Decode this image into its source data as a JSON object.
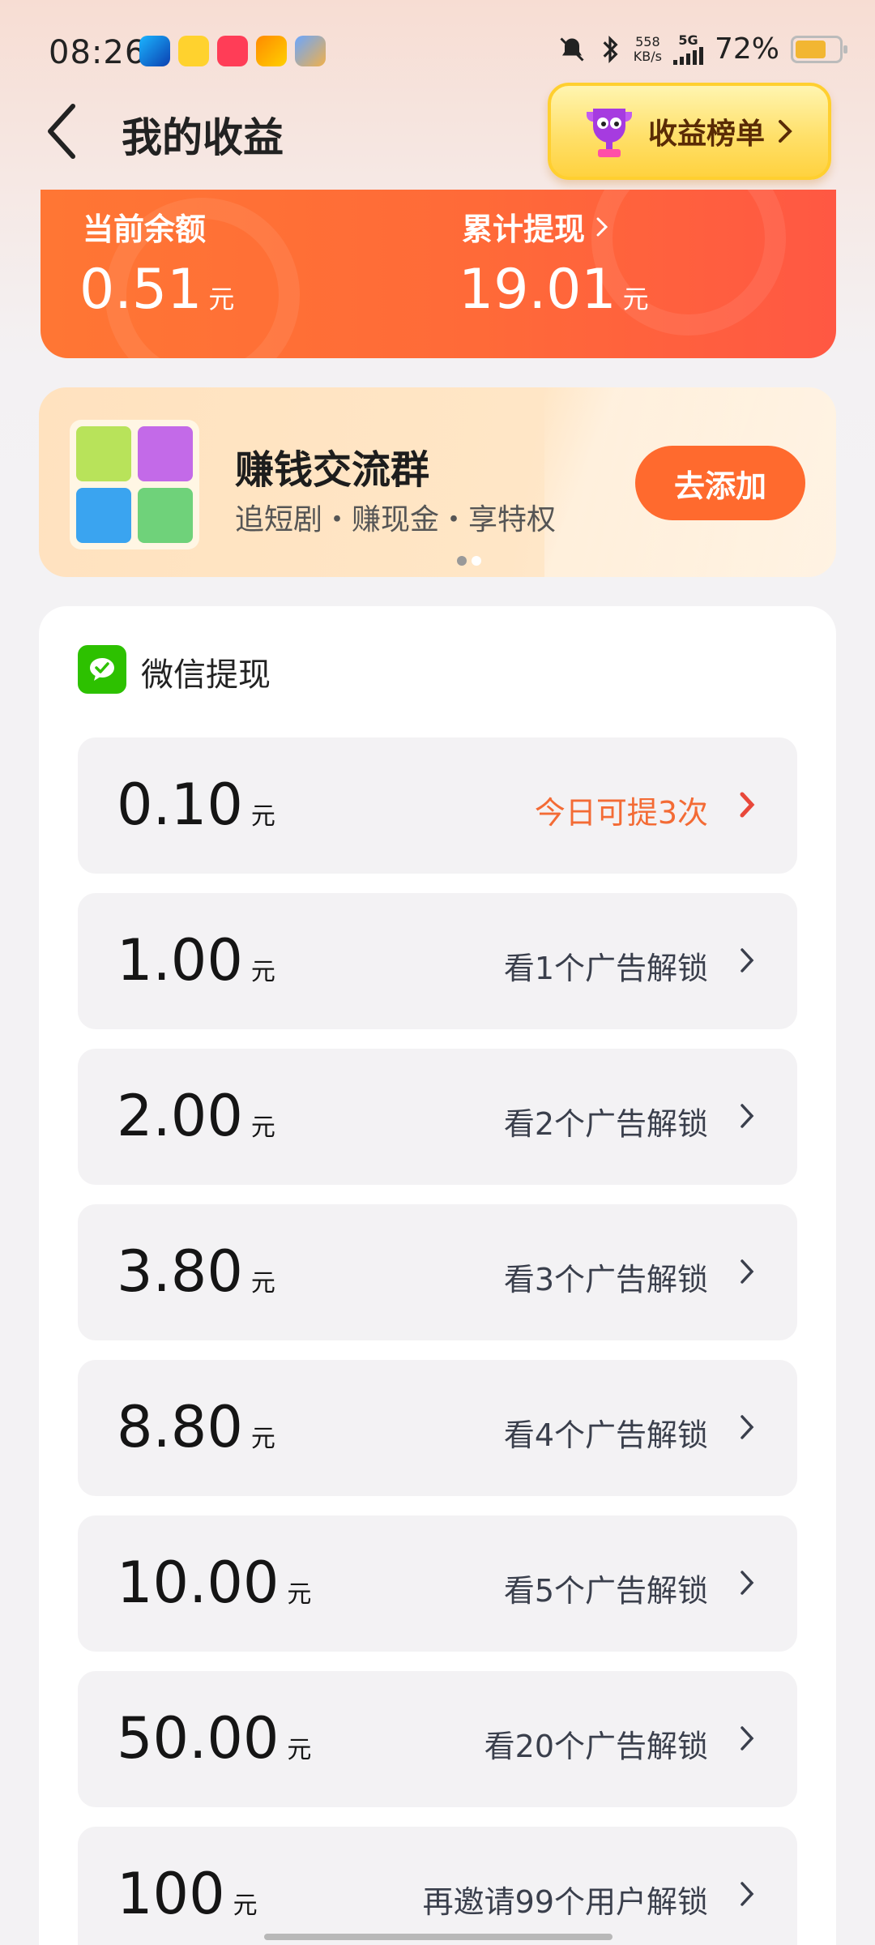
{
  "status": {
    "time": "08:26",
    "net_speed_value": "558",
    "net_speed_unit": "KB/s",
    "network": "5G",
    "battery": "72%",
    "battery_level": 0.72
  },
  "header": {
    "title": "我的收益",
    "rank_button": "收益榜单"
  },
  "balance": {
    "current_label": "当前余额",
    "current_value": "0.51",
    "current_unit": "元",
    "total_label": "累计提现",
    "total_value": "19.01",
    "total_unit": "元"
  },
  "group": {
    "title": "赚钱交流群",
    "subtitle": "追短剧・赚现金・享特权",
    "button": "去添加"
  },
  "withdraw": {
    "title": "微信提现",
    "options": [
      {
        "amount": "0.10",
        "unit": "元",
        "condition": "今日可提3次",
        "highlight": true
      },
      {
        "amount": "1.00",
        "unit": "元",
        "condition": "看1个广告解锁",
        "highlight": false
      },
      {
        "amount": "2.00",
        "unit": "元",
        "condition": "看2个广告解锁",
        "highlight": false
      },
      {
        "amount": "3.80",
        "unit": "元",
        "condition": "看3个广告解锁",
        "highlight": false
      },
      {
        "amount": "8.80",
        "unit": "元",
        "condition": "看4个广告解锁",
        "highlight": false
      },
      {
        "amount": "10.00",
        "unit": "元",
        "condition": "看5个广告解锁",
        "highlight": false
      },
      {
        "amount": "50.00",
        "unit": "元",
        "condition": "看20个广告解锁",
        "highlight": false
      },
      {
        "amount": "100",
        "unit": "元",
        "condition": "再邀请99个用户解锁",
        "highlight": false
      }
    ]
  },
  "colors": {
    "accent_orange": "#ff6a2e",
    "balance_card": "#ff6a38",
    "highlight_text": "#f36b35",
    "wechat_green": "#2dc100"
  }
}
